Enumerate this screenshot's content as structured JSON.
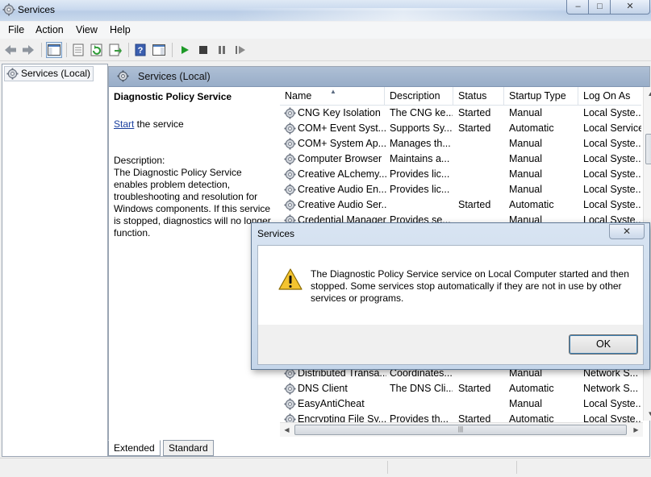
{
  "window": {
    "title": "Services",
    "caption_buttons": {
      "minimize": "–",
      "maximize": "□",
      "close": "✕"
    }
  },
  "menu": [
    "File",
    "Action",
    "View",
    "Help"
  ],
  "toolbar_icons": [
    "back-arrow-icon",
    "forward-arrow-icon",
    "show-hide-console-tree-icon",
    "properties-icon",
    "refresh-icon",
    "export-list-icon",
    "help-icon",
    "show-hide-action-pane-icon",
    "start-service-icon",
    "stop-service-icon",
    "pause-service-icon",
    "restart-service-icon"
  ],
  "tree": {
    "root": "Services (Local)"
  },
  "main": {
    "header": "Services (Local)",
    "selected_service": "Diagnostic Policy Service",
    "start_link": "Start",
    "start_suffix": " the service",
    "description_label": "Description:",
    "description_text": "The Diagnostic Policy Service enables problem detection, troubleshooting and resolution for Windows components.  If this service is stopped, diagnostics will no longer function."
  },
  "list": {
    "columns": [
      "Name",
      "Description",
      "Status",
      "Startup Type",
      "Log On As"
    ],
    "rows_top": [
      [
        "CNG Key Isolation",
        "The CNG ke...",
        "Started",
        "Manual",
        "Local Syste..."
      ],
      [
        "COM+ Event Syst...",
        "Supports Sy...",
        "Started",
        "Automatic",
        "Local Service"
      ],
      [
        "COM+ System Ap...",
        "Manages th...",
        "",
        "Manual",
        "Local Syste..."
      ],
      [
        "Computer Browser",
        "Maintains a...",
        "",
        "Manual",
        "Local Syste..."
      ],
      [
        "Creative ALchemy...",
        "Provides lic...",
        "",
        "Manual",
        "Local Syste..."
      ],
      [
        "Creative Audio En...",
        "Provides lic...",
        "",
        "Manual",
        "Local Syste..."
      ],
      [
        "Creative Audio Ser...",
        "",
        "Started",
        "Automatic",
        "Local Syste..."
      ],
      [
        "Credential Manager",
        "Provides se...",
        "",
        "Manual",
        "Local Syste..."
      ]
    ],
    "rows_bottom": [
      [
        "Distributed Transa...",
        "Coordinates...",
        "",
        "Manual",
        "Network S..."
      ],
      [
        "DNS Client",
        "The DNS Cli...",
        "Started",
        "Automatic",
        "Network S..."
      ],
      [
        "EasyAntiCheat",
        "",
        "",
        "Manual",
        "Local Syste..."
      ],
      [
        "Encrypting File Sy...",
        "Provides th...",
        "Started",
        "Automatic",
        "Local Syste..."
      ]
    ]
  },
  "tabs": [
    "Extended",
    "Standard"
  ],
  "dialog": {
    "title": "Services",
    "close": "✕",
    "message": "The Diagnostic Policy Service service on Local Computer started and then stopped. Some services stop automatically if they are not in use by other services or programs.",
    "ok_label": "OK",
    "icon": "warning-icon"
  }
}
